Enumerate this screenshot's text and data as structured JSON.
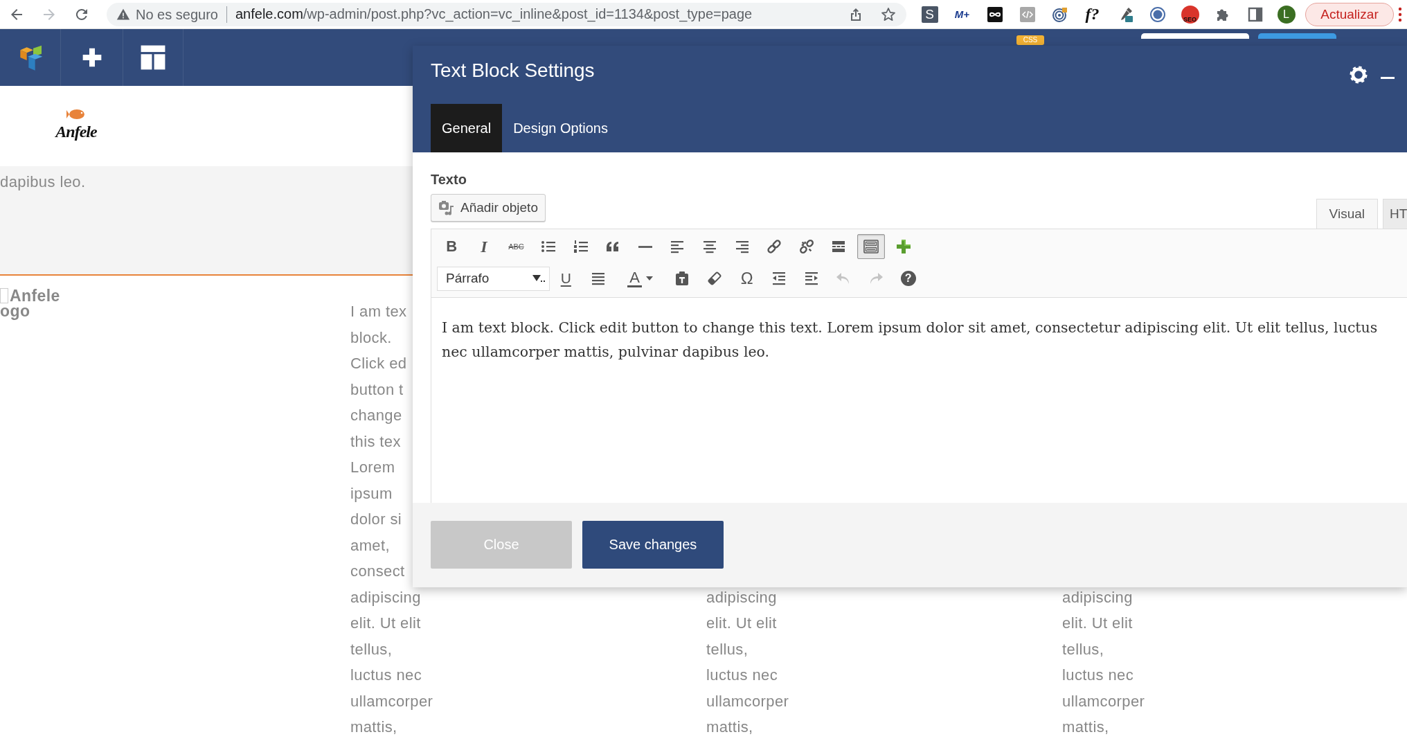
{
  "browser": {
    "security": "No es seguro",
    "url_host": "anfele.com",
    "url_path": "/wp-admin/post.php?vc_action=vc_inline&post_id=1134&post_type=page",
    "extensions": [
      {
        "kind": "tile",
        "label": "S"
      },
      {
        "kind": "brand",
        "label": "M+"
      },
      {
        "kind": "script",
        "label": "f?"
      },
      {
        "kind": "seo",
        "label": "SEO"
      }
    ],
    "profile": "L",
    "update_button": "Actualizar"
  },
  "builder_bar": {
    "css_badge": "CSS"
  },
  "page": {
    "logo_text": "Anfele",
    "band_text": "dapibus leo.",
    "image_alt": [
      "Anfele",
      "ogo"
    ],
    "columns": [
      {
        "lines": [
          "I am tex",
          "block.",
          "Click ed",
          "button t",
          "change",
          "this tex",
          "Lorem",
          "ipsum",
          "dolor si",
          "amet,",
          "consect",
          "adipiscing",
          "elit. Ut elit",
          "tellus,",
          "luctus nec",
          "ullamcorper",
          "mattis,"
        ]
      },
      {
        "lines": [
          "adipiscing",
          "elit. Ut elit",
          "tellus,",
          "luctus nec",
          "ullamcorper",
          "mattis,"
        ]
      },
      {
        "lines": [
          "adipiscing",
          "elit. Ut elit",
          "tellus,",
          "luctus nec",
          "ullamcorper",
          "mattis,"
        ]
      }
    ]
  },
  "modal": {
    "title": "Text Block Settings",
    "tabs": [
      {
        "label": "General",
        "selected": true
      },
      {
        "label": "Design Options",
        "selected": false
      }
    ],
    "field_label": "Texto",
    "add_media_button": "Añadir objeto",
    "editor_tabs": [
      {
        "label": "Visual",
        "selected": true
      },
      {
        "label": "HT",
        "selected": false
      }
    ],
    "toolbar_rows": [
      [
        {
          "kind": "bold",
          "label": "B",
          "pressed": false
        },
        {
          "kind": "italic",
          "label": "I",
          "pressed": false
        },
        {
          "kind": "strike",
          "label": "ABC",
          "pressed": false
        },
        {
          "kind": "icon",
          "pressed": false
        },
        {
          "kind": "icon",
          "pressed": false
        },
        {
          "kind": "icon",
          "pressed": false
        },
        {
          "kind": "icon",
          "pressed": false
        },
        {
          "kind": "icon",
          "pressed": false
        },
        {
          "kind": "icon",
          "pressed": false
        },
        {
          "kind": "icon",
          "pressed": false
        },
        {
          "kind": "icon",
          "pressed": false
        },
        {
          "kind": "icon",
          "pressed": false
        },
        {
          "kind": "icon",
          "pressed": false
        },
        {
          "kind": "icon",
          "pressed": true
        },
        {
          "kind": "icon",
          "pressed": false
        }
      ],
      [
        {
          "kind": "select",
          "label": "Párrafo",
          "disabled": false
        },
        {
          "kind": "underline",
          "label": "U",
          "disabled": false
        },
        {
          "kind": "icon",
          "disabled": false
        },
        {
          "kind": "color",
          "label": "A",
          "disabled": false
        },
        {
          "kind": "icon",
          "disabled": false
        },
        {
          "kind": "icon",
          "disabled": false
        },
        {
          "kind": "glyph",
          "label": "Ω",
          "disabled": false
        },
        {
          "kind": "icon",
          "disabled": false
        },
        {
          "kind": "icon",
          "disabled": false
        },
        {
          "kind": "icon",
          "disabled": true
        },
        {
          "kind": "icon",
          "disabled": true
        },
        {
          "kind": "help",
          "label": "?",
          "disabled": false
        }
      ]
    ],
    "content": "I am text block. Click edit button to change this text. Lorem ipsum dolor sit amet, consectetur adipiscing elit. Ut elit tellus, luctus nec ullamcorper mattis, pulvinar dapibus leo.",
    "buttons": [
      {
        "kind": "secondary",
        "label": "Close"
      },
      {
        "kind": "primary",
        "label": "Save changes"
      }
    ]
  }
}
